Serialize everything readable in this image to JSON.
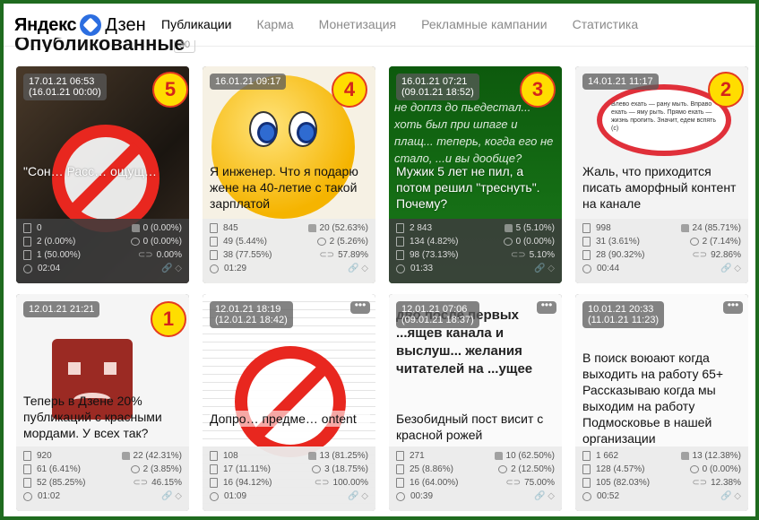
{
  "header": {
    "logo_text": "Яндекс",
    "logo_dzen": "Дзен",
    "nav": [
      "Публикации",
      "Карма",
      "Монетизация",
      "Рекламные кампании",
      "Статистика"
    ],
    "active_nav": "Публикации"
  },
  "section": {
    "title": "Опубликованные",
    "count": "30"
  },
  "accent_colors": {
    "rank_fill": "#ffdd00",
    "rank_border": "#e53b1f",
    "no_sign": "#e8271f",
    "frame": "#1f6b1f"
  },
  "cards": [
    {
      "date1": "17.01.21 06:53",
      "date2": "(16.01.21 00:00)",
      "rank": "5",
      "title": "\"Сон… Расс… ощущ…",
      "views": "0",
      "reads": "2 (0.00%)",
      "finished": "1 (50.00%)",
      "time": "02:04",
      "likes": "0 (0.00%)",
      "comments": "0 (0.00%)",
      "ctr": "0.00%"
    },
    {
      "date1": "16.01.21 09:17",
      "date2": "",
      "rank": "4",
      "title": "Я инженер. Что я подарю жене на 40-летие с такой зарплатой",
      "views": "845",
      "reads": "49 (5.44%)",
      "finished": "38 (77.55%)",
      "time": "01:29",
      "likes": "20 (52.63%)",
      "comments": "2 (5.26%)",
      "ctr": "57.89%"
    },
    {
      "date1": "16.01.21 07:21",
      "date2": "(09.01.21 18:52)",
      "rank": "3",
      "title": "Мужик 5 лет не пил, а потом решил \"треснуть\". Почему?",
      "views": "2 843",
      "reads": "134 (4.82%)",
      "finished": "98 (73.13%)",
      "time": "01:33",
      "likes": "5 (5.10%)",
      "comments": "0 (0.00%)",
      "ctr": "5.10%"
    },
    {
      "date1": "14.01.21 11:17",
      "date2": "",
      "rank": "2",
      "title": "Жаль, что приходится писать аморфный контент на канале",
      "views": "998",
      "reads": "31 (3.61%)",
      "finished": "28 (90.32%)",
      "time": "00:44",
      "likes": "24 (85.71%)",
      "comments": "2 (7.14%)",
      "ctr": "92.86%"
    },
    {
      "date1": "12.01.21 21:21",
      "date2": "",
      "rank": "1",
      "title": "Теперь в Дзене 20% публикаций с красными мордами. У всех так?",
      "views": "920",
      "reads": "61 (6.41%)",
      "finished": "52 (85.25%)",
      "time": "01:02",
      "likes": "22 (42.31%)",
      "comments": "2 (3.85%)",
      "ctr": "46.15%"
    },
    {
      "date1": "12.01.21 18:19",
      "date2": "(12.01.21 18:42)",
      "rank": "",
      "title": "Допро… предме… ontent",
      "views": "108",
      "reads": "17 (11.11%)",
      "finished": "16 (94.12%)",
      "time": "01:09",
      "likes": "13 (81.25%)",
      "comments": "3 (18.75%)",
      "ctr": "100.00%"
    },
    {
      "date1": "12.01.21 07:06",
      "date2": "(09.01.21 18:37)",
      "rank": "",
      "title": "Безобидный пост висит с красной рожей",
      "views": "271",
      "reads": "25 (8.86%)",
      "finished": "16 (64.00%)",
      "time": "00:39",
      "likes": "10 (62.50%)",
      "comments": "2 (12.50%)",
      "ctr": "75.00%"
    },
    {
      "date1": "10.01.21 20:33",
      "date2": "(11.01.21 11:23)",
      "rank": "",
      "title": "В поиск воюают когда выходить на работу 65+ Рассказываю когда мы выходим на работу Подмосковье в нашей организации",
      "views": "1 662",
      "reads": "128 (4.57%)",
      "finished": "105 (82.03%)",
      "time": "00:52",
      "likes": "13 (12.38%)",
      "comments": "0 (0.00%)",
      "ctr": "12.38%"
    }
  ],
  "thumb_texts": {
    "c3_bg_text": "не доплз до пьедестал... хоть был при шпаге и плащ... теперь, когда его не стало, ...и вы дообще?",
    "c4_note": "Влево ехать — рану мыть. Вправо ехать — яму рыть. Прямо ехать — жизнь пропить. Значит, едем вспять (с)",
    "c7_bg_text": "дво после первых ...ящев канала и выслуш... желания читателей на ...ущее"
  }
}
